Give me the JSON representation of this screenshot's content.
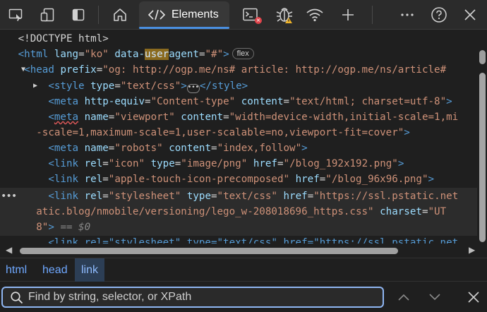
{
  "toolbar": {
    "elements_tab_label": "Elements",
    "icons": [
      "device-emulation-icon",
      "dock-icon",
      "sidebar-toggle-icon",
      "welcome-home-icon",
      "elements-icon",
      "console-icon",
      "sources-bug-icon",
      "network-wifi-icon",
      "add-tool-icon",
      "more-icon",
      "help-icon",
      "close-icon"
    ],
    "accent_color": "#4a8fe0",
    "error_badge_color": "#e0444b",
    "warning_badge_color": "#f0b429"
  },
  "dom": {
    "line1": "<!DOCTYPE html>",
    "l2_open": "<html",
    "l2_a1": "lang",
    "l2_v1": "\"ko\"",
    "l2_a2_pre": "data-",
    "l2_a2_hl": "user",
    "l2_a2_post": "agent",
    "l2_v2": "\"#\"",
    "l2_close": ">",
    "l2_badge": "flex",
    "l3_open": "<head",
    "l3_a1": "prefix",
    "l3_v1": "\"og: http://ogp.me/ns# article: http://ogp.me/ns/article#",
    "l4_open": "<style",
    "l4_a1": "type",
    "l4_v1": "\"text/css\"",
    "l4_close": ">",
    "l4_badge": "•••",
    "l4_end": "</style>",
    "l5_open": "<meta",
    "l5_a1": "http-equiv",
    "l5_v1": "\"Content-type\"",
    "l5_a2": "content",
    "l5_v2": "\"text/html; charset=utf-8\"",
    "l5_close": ">",
    "l6_lt": "<",
    "l6_tag": "meta",
    "l6_a1": "name",
    "l6_v1": "\"viewport\"",
    "l6_a2": "content",
    "l6_v2": "\"width=device-width,initial-scale=1,mi",
    "l7_v": "-scale=1,maximum-scale=1,user-scalable=no,viewport-fit=cover\"",
    "l7_close": ">",
    "l8_open": "<meta",
    "l8_a1": "name",
    "l8_v1": "\"robots\"",
    "l8_a2": "content",
    "l8_v2": "\"index,follow\"",
    "l8_close": ">",
    "l9_open": "<link",
    "l9_a1": "rel",
    "l9_v1": "\"icon\"",
    "l9_a2": "type",
    "l9_v2": "\"image/png\"",
    "l9_a3": "href",
    "l9_v3": "\"/blog_192x192.png\"",
    "l9_close": ">",
    "l10_open": "<link",
    "l10_a1": "rel",
    "l10_v1": "\"apple-touch-icon-precomposed\"",
    "l10_a2": "href",
    "l10_v2": "\"/blog_96x96.png\"",
    "l10_close": ">",
    "l11_dots": "•••",
    "l11_open": "<link",
    "l11_a1": "rel",
    "l11_v1": "\"stylesheet\"",
    "l11_a2": "type",
    "l11_v2": "\"text/css\"",
    "l11_a3": "href",
    "l11_v3": "\"https://ssl.pstatic.net",
    "l12_v": "atic.blog/nmobile/versioning/lego_w-208018696_https.css\"",
    "l12_a": "charset",
    "l12_v2": "\"UT",
    "l13_v": "8\"",
    "l13_close": ">",
    "l13_ref": "== $0",
    "l14_text": "<link rel=\"stylesheet\" type=\"text/css\" href=\"https://ssl.pstatic.net"
  },
  "breadcrumbs": [
    "html",
    "head",
    "link"
  ],
  "search": {
    "placeholder": "Find by string, selector, or XPath"
  }
}
